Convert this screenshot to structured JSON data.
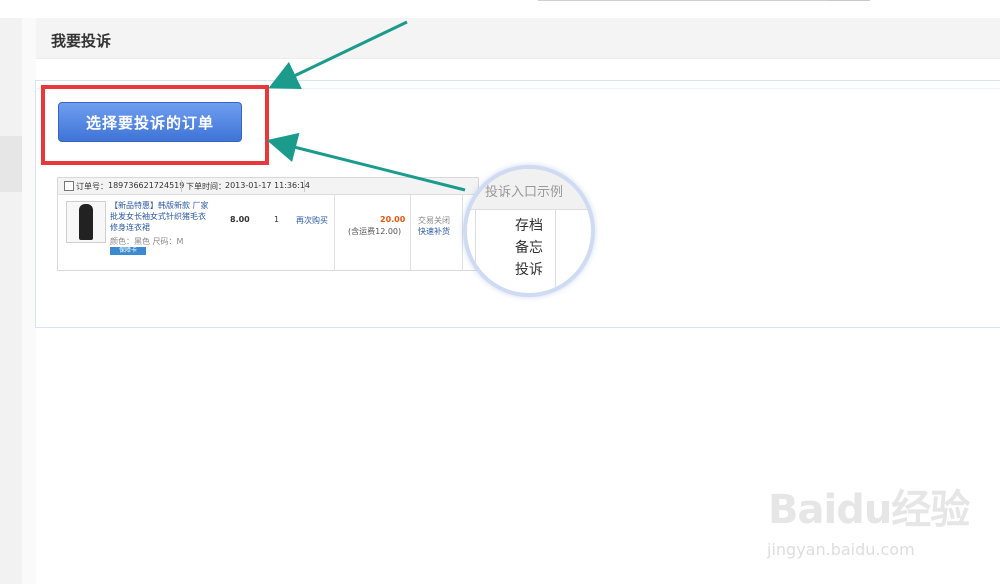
{
  "header": {
    "title": "我要投诉"
  },
  "main": {
    "select_order_button": "选择要投诉的订单"
  },
  "order": {
    "order_no_label": "订单号：",
    "order_no": "189736621724519",
    "order_time_label": "下单时间：",
    "order_time": "2013-01-17 11:36:14",
    "product_title": "【新品特惠】韩版新款 厂家批发女长袖女式针织猪毛衣修身连衣裙",
    "product_attrs": "颜色：黑色  尺码：M",
    "badge": "保障卡",
    "price": "8.00",
    "quantity": "1",
    "rebuy": "再次购买",
    "total": "20.00",
    "shipping": "(含运费12.00)",
    "status": "交易关闭",
    "status_link": "快速补货"
  },
  "callout": {
    "title": "投诉入口示例",
    "items": [
      "存档",
      "备忘",
      "投诉"
    ]
  },
  "watermark": {
    "logo": "Baidu经验",
    "url": "jingyan.baidu.com"
  },
  "colors": {
    "highlight": "#e8383d",
    "button": "#4b7fdc",
    "arrow": "#1a9b8c",
    "link": "#2a58a8",
    "price": "#e4570e"
  }
}
